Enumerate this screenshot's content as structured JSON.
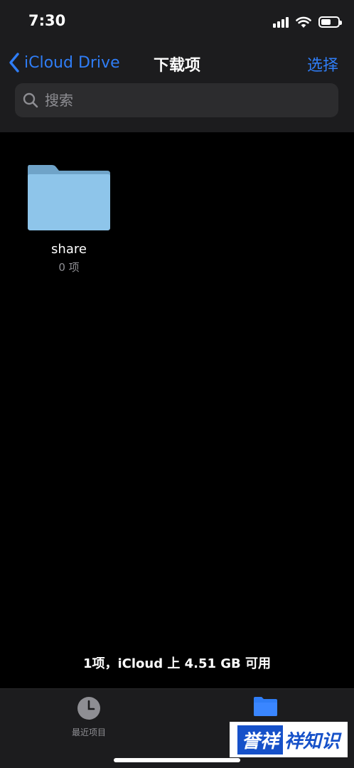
{
  "status_bar": {
    "time": "7:30",
    "battery_level_percent": 60,
    "icons": [
      "cellular-signal-icon",
      "wifi-icon",
      "battery-icon"
    ]
  },
  "nav": {
    "back_label": "iCloud Drive",
    "title": "下载项",
    "select_label": "选择"
  },
  "search": {
    "placeholder": "搜索",
    "value": ""
  },
  "items": [
    {
      "name": "share",
      "count": "0 项",
      "icon": "folder-icon"
    }
  ],
  "footer": {
    "storage_text": "1项，iCloud 上 4.51 GB 可用"
  },
  "tab_bar": {
    "recent_label": "最近项目",
    "recent_icon": "clock-icon",
    "browse_icon": "folder-icon",
    "active_tab": "browse"
  },
  "watermark": {
    "part1": "誉祥",
    "part2": "祥知识"
  },
  "colors": {
    "accent": "#2f7df6",
    "folder": "#8ec5ea",
    "background": "#000000",
    "bar_background": "#1c1c1e",
    "secondary_text": "#8e8e93"
  }
}
